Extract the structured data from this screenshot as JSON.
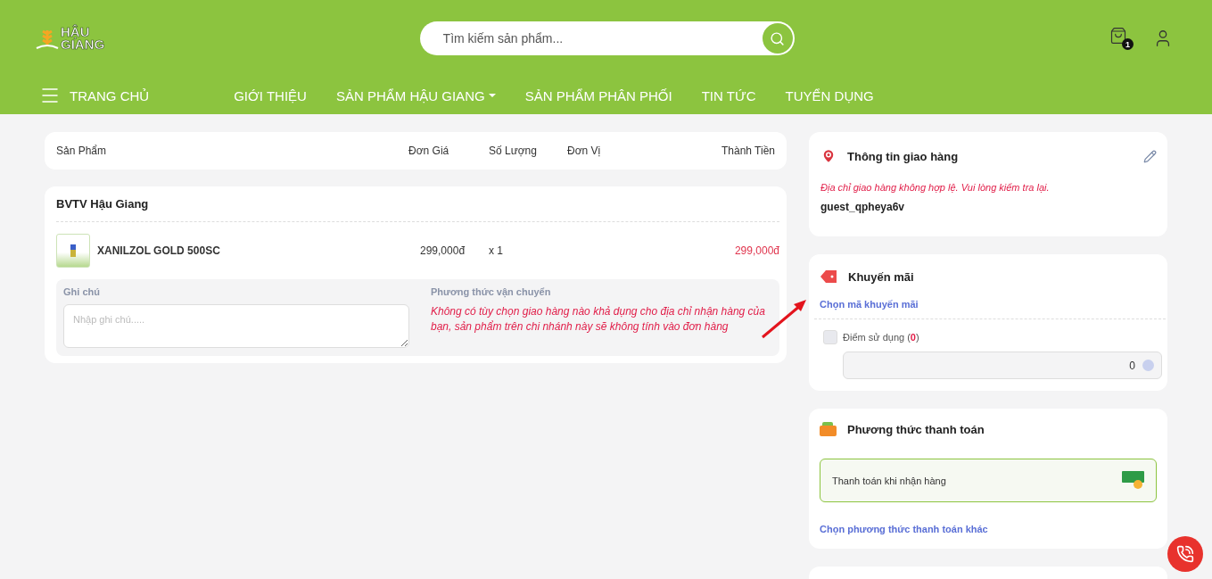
{
  "header": {
    "logo": [
      "HẬU",
      "GIANG"
    ],
    "search": {
      "placeholder": "Tìm kiếm sản phẩm..."
    },
    "cart_count": "1"
  },
  "nav": [
    {
      "label": "TRANG CHỦ",
      "has_dropdown": false
    },
    {
      "label": "GIỚI THIỆU",
      "has_dropdown": false
    },
    {
      "label": "SẢN PHẨM HẬU GIANG",
      "has_dropdown": true
    },
    {
      "label": "SẢN PHẨM PHÂN PHỐI",
      "has_dropdown": false
    },
    {
      "label": "TIN TỨC",
      "has_dropdown": false
    },
    {
      "label": "TUYỂN DỤNG",
      "has_dropdown": false
    }
  ],
  "table": {
    "columns": [
      "Sản Phẩm",
      "Đơn Giá",
      "Số Lượng",
      "Đơn Vị",
      "Thành Tiền"
    ]
  },
  "store": {
    "name": "BVTV Hậu Giang",
    "items": [
      {
        "name": "XANILZOL GOLD 500SC",
        "price": "299,000đ",
        "quantity": "x 1",
        "total": "299,000đ"
      }
    ],
    "note": {
      "label": "Ghi chú",
      "placeholder": "Nhập ghi chú....."
    },
    "shipping": {
      "label": "Phương thức vận chuyển",
      "message": "Không có tùy chọn giao hàng nào khả dụng cho địa chỉ nhận hàng của bạn, sản phẩm trên chi nhánh này sẽ không tính vào đơn hàng"
    }
  },
  "delivery": {
    "title": "Thông tin giao hàng",
    "error": "Địa chỉ giao hàng không hợp lệ. Vui lòng kiểm tra lại.",
    "name": "guest_qpheya6v"
  },
  "promotion": {
    "title": "Khuyến mãi",
    "link": "Chọn mã khuyến mãi",
    "points": {
      "label": "Điểm sử dụng (**0**)",
      "checked": false,
      "value": "0"
    }
  },
  "payment": {
    "title": "Phương thức thanh toán",
    "options": [
      {
        "label": "Thanh toán khi nhận hàng",
        "selected": true
      }
    ],
    "link": "Chọn phương thức thanh toán khác"
  }
}
